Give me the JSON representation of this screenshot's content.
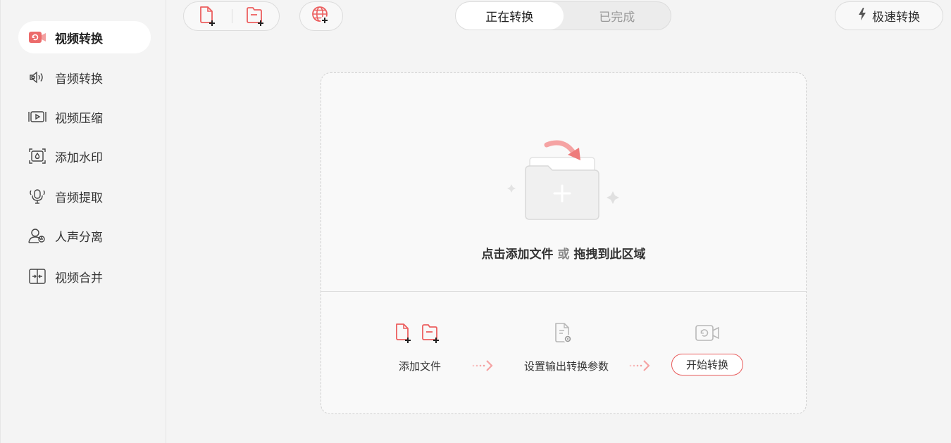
{
  "sidebar": {
    "items": [
      {
        "label": "视频转换",
        "icon": "video-convert-icon",
        "active": true
      },
      {
        "label": "音频转换",
        "icon": "audio-convert-icon",
        "active": false
      },
      {
        "label": "视频压缩",
        "icon": "video-compress-icon",
        "active": false
      },
      {
        "label": "添加水印",
        "icon": "watermark-icon",
        "active": false
      },
      {
        "label": "音频提取",
        "icon": "audio-extract-icon",
        "active": false
      },
      {
        "label": "人声分离",
        "icon": "vocal-separate-icon",
        "active": false
      },
      {
        "label": "视频合并",
        "icon": "video-merge-icon",
        "active": false
      }
    ]
  },
  "toolbar": {
    "add_file_icon": "add-file-icon",
    "add_folder_icon": "add-folder-icon",
    "add_url_icon": "add-url-globe-icon"
  },
  "tabs": {
    "converting": "正在转换",
    "completed": "已完成"
  },
  "speed_button": {
    "label": "极速转换",
    "icon": "lightning-icon"
  },
  "dropzone": {
    "prompt_part1": "点击添加文件",
    "prompt_or": "或",
    "prompt_part2": "拖拽到此区域"
  },
  "steps": {
    "step1_label": "添加文件",
    "step2_label": "设置输出转换参数",
    "step3_label": "开始转换"
  },
  "colors": {
    "accent": "#e85a5a",
    "accent_light": "#f5a3a3",
    "sidebar_bg": "#f4f4f4",
    "active_item_bg": "#ffffff"
  }
}
